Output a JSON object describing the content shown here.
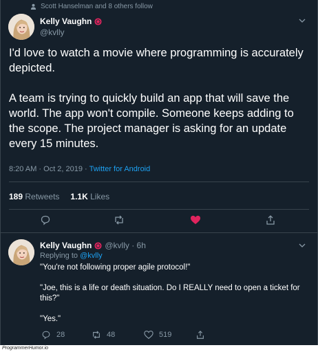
{
  "social_context": "Scott Hanselman and 8 others follow",
  "main_tweet": {
    "display_name": "Kelly Vaughn",
    "handle": "@kvlly",
    "paragraphs": [
      "I'd love to watch a movie where programming is accurately depicted.",
      "A team is trying to quickly build an app that will save the world. The app won't compile. Someone keeps adding to the scope. The project manager is asking for an update every 15 minutes."
    ],
    "timestamp": "8:20 AM · Oct 2, 2019 · ",
    "source": "Twitter for Android",
    "retweets_count": "189",
    "retweets_label": "Retweets",
    "likes_count": "1.1K",
    "likes_label": "Likes",
    "liked": true
  },
  "reply_tweet": {
    "display_name": "Kelly Vaughn",
    "handle_time": "@kvlly · 6h",
    "replying_prefix": "Replying to ",
    "replying_to": "@kvlly",
    "lines": [
      "\"You're not following proper agile protocol!\"",
      "\"Joe, this is a life or death situation. Do I REALLY need to open a ticket for this?\"",
      "\"Yes.\""
    ],
    "reply_count": "28",
    "retweet_count": "48",
    "like_count": "519"
  },
  "watermark": "ProgrammerHumor.io",
  "colors": {
    "background": "#15202b",
    "accent": "#1da1f2",
    "like": "#e0245e",
    "muted": "#8899a6"
  }
}
